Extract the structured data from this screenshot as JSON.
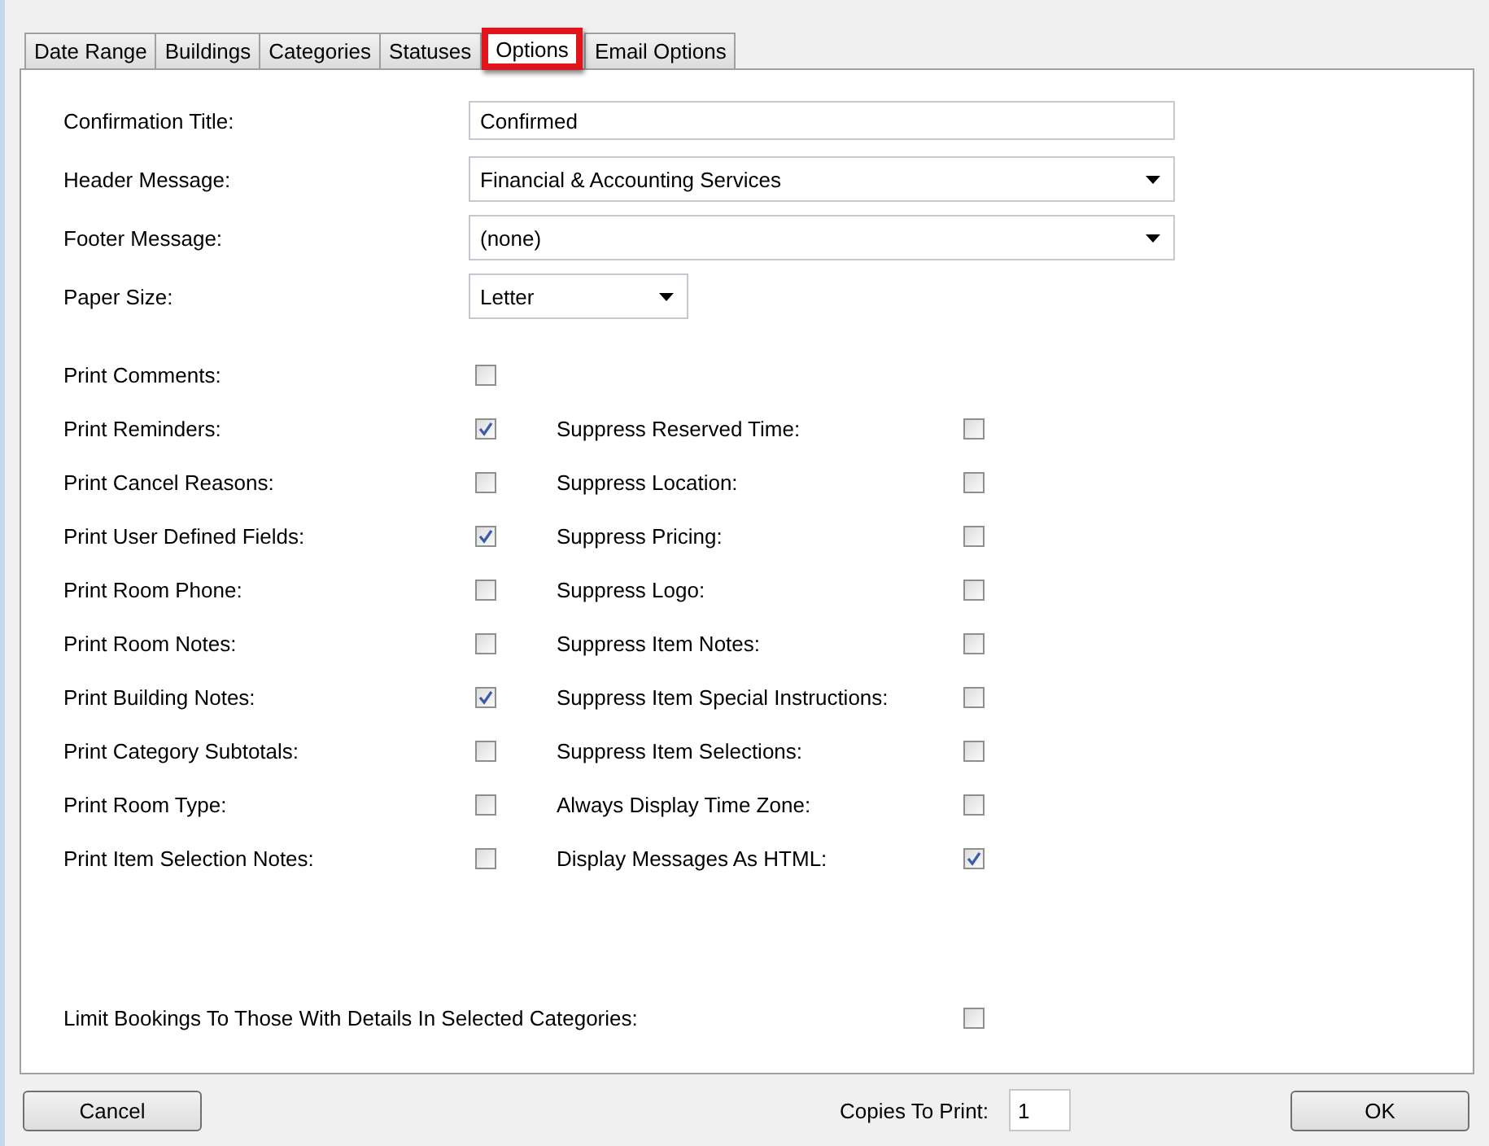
{
  "tabs": [
    {
      "label": "Date Range",
      "selected": false
    },
    {
      "label": "Buildings",
      "selected": false
    },
    {
      "label": "Categories",
      "selected": false
    },
    {
      "label": "Statuses",
      "selected": false
    },
    {
      "label": "Options",
      "selected": true
    },
    {
      "label": "Email Options",
      "selected": false
    }
  ],
  "fields": [
    {
      "label": "Confirmation Title:",
      "kind": "text",
      "value": "Confirmed"
    },
    {
      "label": "Header Message:",
      "kind": "dropdown",
      "value": "Financial & Accounting Services"
    },
    {
      "label": "Footer Message:",
      "kind": "dropdown",
      "value": "(none)"
    },
    {
      "label": "Paper Size:",
      "kind": "small-dropdown",
      "value": "Letter"
    }
  ],
  "options": [
    {
      "label": "Print Comments:",
      "checked": false
    },
    {
      "label": "Print Reminders:",
      "checked": true,
      "right": {
        "label": "Suppress Reserved Time:",
        "checked": false
      }
    },
    {
      "label": "Print Cancel Reasons:",
      "checked": false,
      "right": {
        "label": "Suppress Location:",
        "checked": false
      }
    },
    {
      "label": "Print User Defined Fields:",
      "checked": true,
      "right": {
        "label": "Suppress Pricing:",
        "checked": false
      }
    },
    {
      "label": "Print Room Phone:",
      "checked": false,
      "right": {
        "label": "Suppress Logo:",
        "checked": false
      }
    },
    {
      "label": "Print Room Notes:",
      "checked": false,
      "right": {
        "label": "Suppress Item Notes:",
        "checked": false
      }
    },
    {
      "label": "Print Building Notes:",
      "checked": true,
      "right": {
        "label": "Suppress Item Special Instructions:",
        "checked": false
      }
    },
    {
      "label": "Print Category Subtotals:",
      "checked": false,
      "right": {
        "label": "Suppress Item Selections:",
        "checked": false
      }
    },
    {
      "label": "Print Room Type:",
      "checked": false,
      "right": {
        "label": "Always Display Time Zone:",
        "checked": false
      }
    },
    {
      "label": "Print Item Selection Notes:",
      "checked": false,
      "right": {
        "label": "Display Messages As HTML:",
        "checked": true
      }
    }
  ],
  "limit": {
    "label": "Limit Bookings To Those With Details In Selected Categories:",
    "checked": false
  },
  "footer": {
    "cancel": "Cancel",
    "copies_label": "Copies To Print:",
    "copies": "1",
    "ok": "OK"
  }
}
